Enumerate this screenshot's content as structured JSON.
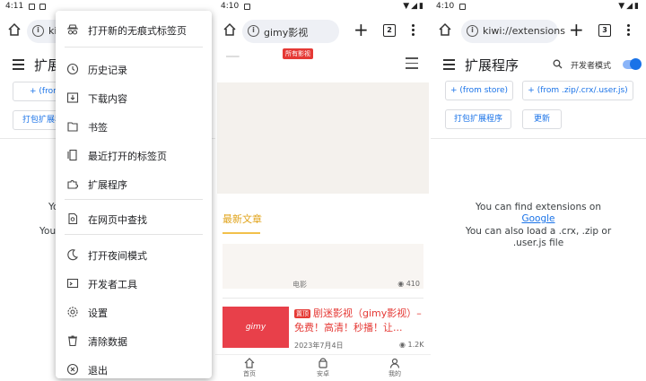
{
  "panel1": {
    "status": {
      "time": "4:11"
    },
    "url": "ki",
    "title": "扩展程",
    "buttons": {
      "from_store": "+ (from st",
      "pack": "打包扩展程"
    },
    "msg_line1": "Yo",
    "msg_line2": "You"
  },
  "menu": {
    "items": [
      {
        "label": "打开新的无痕式标签页",
        "icon": "incognito-icon"
      },
      {
        "label": "历史记录",
        "icon": "history-icon"
      },
      {
        "label": "下载内容",
        "icon": "download-icon"
      },
      {
        "label": "书签",
        "icon": "bookmark-icon"
      },
      {
        "label": "最近打开的标签页",
        "icon": "recent-tabs-icon"
      },
      {
        "label": "扩展程序",
        "icon": "extension-icon"
      },
      {
        "label": "在网页中查找",
        "icon": "find-in-page-icon"
      },
      {
        "label": "打开夜间模式",
        "icon": "night-mode-icon"
      },
      {
        "label": "开发者工具",
        "icon": "developer-tools-icon"
      },
      {
        "label": "设置",
        "icon": "settings-icon"
      },
      {
        "label": "清除数据",
        "icon": "clear-data-icon"
      },
      {
        "label": "退出",
        "icon": "exit-icon"
      }
    ]
  },
  "panel2": {
    "status": {
      "time": "4:10"
    },
    "url": "gimy影视",
    "tab_count": "2",
    "badge": "所有影视",
    "section_title": "最新文章",
    "article1": {
      "title_fragment": "电影",
      "views": "410"
    },
    "article2": {
      "tag": "置顶",
      "title": "剧迷影视（gimy影视）– 免费！高清！秒播！让...",
      "date": "2023年7月4日",
      "views": "1.2K",
      "thumb_text": "gimy"
    },
    "nav": {
      "home": "首页",
      "android": "安卓",
      "mine": "我的"
    }
  },
  "panel3": {
    "status": {
      "time": "4:10"
    },
    "url": "kiwi://extensions",
    "tab_count": "3",
    "title": "扩展程序",
    "dev_mode_label": "开发者模式",
    "buttons": {
      "from_store": "+ (from store)",
      "from_file": "+ (from .zip/.crx/.user.js)",
      "pack": "打包扩展程序",
      "update": "更新"
    },
    "msg": {
      "line1": "You can find extensions on",
      "link": "Google",
      "line2": "You can also load a .crx, .zip or",
      "line3": ".user.js file"
    }
  },
  "colors": {
    "accent": "#1a73e8",
    "brand_red": "#e53935",
    "section_gold": "#e0a31a"
  }
}
